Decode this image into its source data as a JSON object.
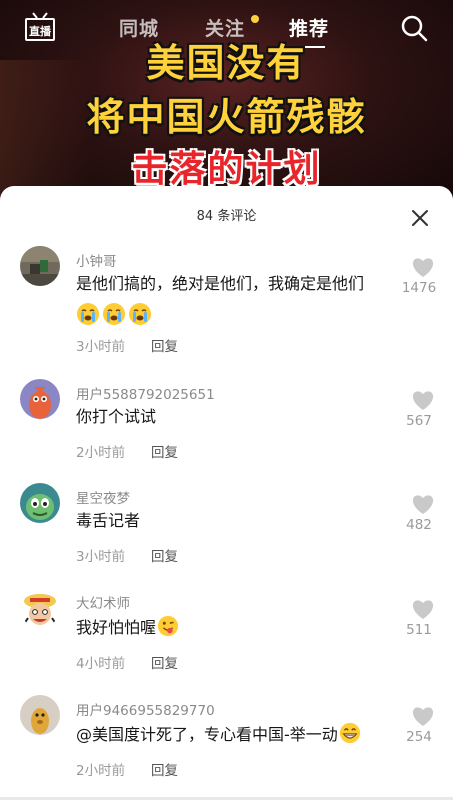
{
  "topnav": {
    "live_label": "直播",
    "tabs": [
      {
        "label": "同城"
      },
      {
        "label": "关注"
      },
      {
        "label": "推荐"
      }
    ],
    "active_tab": "推荐"
  },
  "video": {
    "headline_line1": "美国没有",
    "headline_line2": "将中国火箭残骸",
    "headline_line3": "击落的计划"
  },
  "comments_panel": {
    "count_label": "84 条评论",
    "comments": [
      {
        "username": "小钟哥",
        "text": "是他们搞的，绝对是他们，我确定是他们",
        "emojis": [
          "crying-face",
          "crying-face",
          "crying-face"
        ],
        "time": "3小时前",
        "reply_label": "回复",
        "likes": "1476"
      },
      {
        "username": "用户5588792025651",
        "text": "你打个试试",
        "time": "2小时前",
        "reply_label": "回复",
        "likes": "567"
      },
      {
        "username": "星空夜梦",
        "text": "毒舌记者",
        "time": "3小时前",
        "reply_label": "回复",
        "likes": "482"
      },
      {
        "username": "大幻术师",
        "text": "我好怕怕喔",
        "inline_emoji": "winking-tongue-face",
        "time": "4小时前",
        "reply_label": "回复",
        "likes": "511"
      },
      {
        "username": "用户9466955829770",
        "text": "@美国度计死了，专心看中国-举一动",
        "inline_emoji": "grinning-face",
        "time": "2小时前",
        "reply_label": "回复",
        "likes": "254"
      }
    ]
  },
  "colors": {
    "headline_yellow": "#ffd23c",
    "headline_red": "#e8252b",
    "follow_dot": "#fbd13a",
    "muted_text": "#9a9a9a"
  }
}
